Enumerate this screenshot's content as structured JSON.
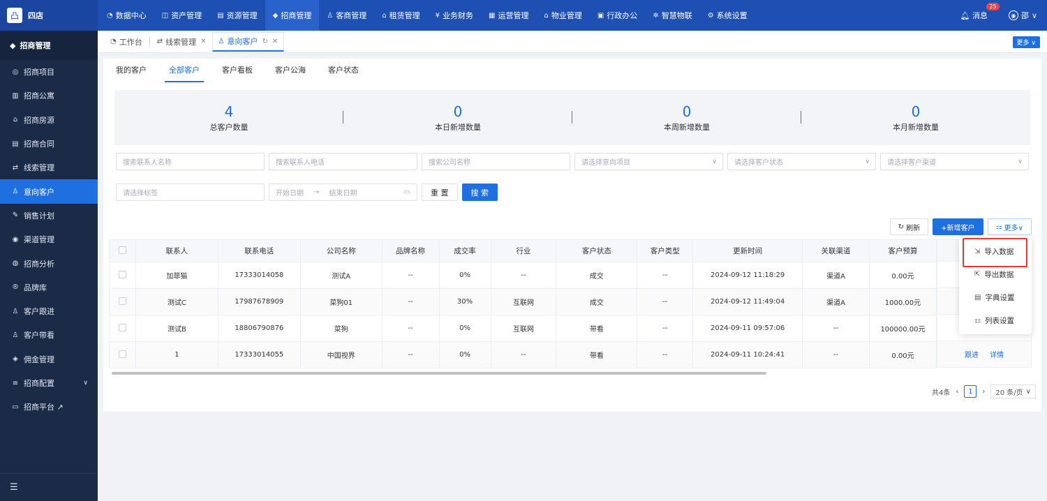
{
  "app": {
    "name": "四店",
    "logo_glyph": "凸"
  },
  "topnav": [
    {
      "icon": "◔",
      "label": "数据中心"
    },
    {
      "icon": "◫",
      "label": "资产管理"
    },
    {
      "icon": "▤",
      "label": "资源管理"
    },
    {
      "icon": "◆",
      "label": "招商管理"
    },
    {
      "icon": "♙",
      "label": "客商管理"
    },
    {
      "icon": "⌂",
      "label": "租赁管理"
    },
    {
      "icon": "¥",
      "label": "业务财务"
    },
    {
      "icon": "▦",
      "label": "运营管理"
    },
    {
      "icon": "⌂",
      "label": "物业管理"
    },
    {
      "icon": "▣",
      "label": "行政办公"
    },
    {
      "icon": "✲",
      "label": "智慧物联"
    },
    {
      "icon": "⚙",
      "label": "系统设置"
    }
  ],
  "header": {
    "message_label": "消息",
    "message_count": "25",
    "user_name": "邵"
  },
  "sidebar": {
    "title": "招商管理",
    "items": [
      {
        "icon": "◎",
        "label": "招商项目"
      },
      {
        "icon": "▥",
        "label": "招商公寓"
      },
      {
        "icon": "⌂",
        "label": "招商房源"
      },
      {
        "icon": "▤",
        "label": "招商合同"
      },
      {
        "icon": "⇄",
        "label": "线索管理"
      },
      {
        "icon": "♙",
        "label": "意向客户"
      },
      {
        "icon": "✎",
        "label": "销售计划"
      },
      {
        "icon": "◉",
        "label": "渠道管理"
      },
      {
        "icon": "◍",
        "label": "招商分析"
      },
      {
        "icon": "®",
        "label": "品牌库"
      },
      {
        "icon": "♙",
        "label": "客户跟进"
      },
      {
        "icon": "♙",
        "label": "客户带看"
      },
      {
        "icon": "◈",
        "label": "佣金管理"
      },
      {
        "icon": "≡",
        "label": "招商配置"
      },
      {
        "icon": "▭",
        "label": "招商平台 ↗"
      }
    ],
    "collapse_glyph": "☰"
  },
  "tabs": [
    {
      "icon": "◔",
      "label": "工作台"
    },
    {
      "icon": "⇄",
      "label": "线索管理"
    },
    {
      "icon": "♙",
      "label": "意向客户"
    }
  ],
  "tabs_more": "更多 ∨",
  "subtabs": [
    "我的客户",
    "全部客户",
    "客户看板",
    "客户公海",
    "客户状态"
  ],
  "stats": [
    {
      "value": "4",
      "label": "总客户数量"
    },
    {
      "value": "0",
      "label": "本日新增数量"
    },
    {
      "value": "0",
      "label": "本周新增数量"
    },
    {
      "value": "0",
      "label": "本月新增数量"
    }
  ],
  "filters": {
    "contact_name": "搜索联系人名称",
    "contact_phone": "搜索联系人电话",
    "company": "搜索公司名称",
    "project": "请选择意向项目",
    "status": "请选择客户状态",
    "channel": "请选择客户渠道",
    "tags": "请选择标签",
    "start_date": "开始日期",
    "end_date": "结束日期",
    "reset": "重 置",
    "search": "搜 索"
  },
  "actions": {
    "refresh": "刷新",
    "add": "+新增客户",
    "more": "更多∨"
  },
  "table": {
    "headers": [
      "联系人",
      "联系电话",
      "公司名称",
      "品牌名称",
      "成交率",
      "行业",
      "客户状态",
      "客户类型",
      "更新时间",
      "关联渠道",
      "客户预算"
    ],
    "rows": [
      [
        "加菲猫",
        "17333014058",
        "测试A",
        "--",
        "0%",
        "--",
        "成交",
        "--",
        "2024-09-12 11:18:29",
        "渠道A",
        "0.00元"
      ],
      [
        "测试C",
        "17987678909",
        "菜狗01",
        "--",
        "30%",
        "互联网",
        "成交",
        "--",
        "2024-09-12 11:49:04",
        "渠道A",
        "1000.00元"
      ],
      [
        "测试B",
        "18806790876",
        "菜狗",
        "--",
        "0%",
        "互联网",
        "带看",
        "--",
        "2024-09-11 09:57:06",
        "--",
        "100000.00元"
      ],
      [
        "1",
        "17333014055",
        "中国视界",
        "--",
        "0%",
        "--",
        "带看",
        "--",
        "2024-09-11 10:24:41",
        "--",
        "0.00元"
      ]
    ],
    "row_ops": [
      "跟进",
      "详情"
    ]
  },
  "pager": {
    "total": "共4条",
    "page": "1",
    "size": "20 条/页"
  },
  "dropdown": {
    "items": [
      {
        "icon": "⇲",
        "label": "导入数据"
      },
      {
        "icon": "⇱",
        "label": "导出数据"
      },
      {
        "icon": "▤",
        "label": "字典设置"
      },
      {
        "icon": "⚏",
        "label": "列表设置"
      }
    ]
  }
}
